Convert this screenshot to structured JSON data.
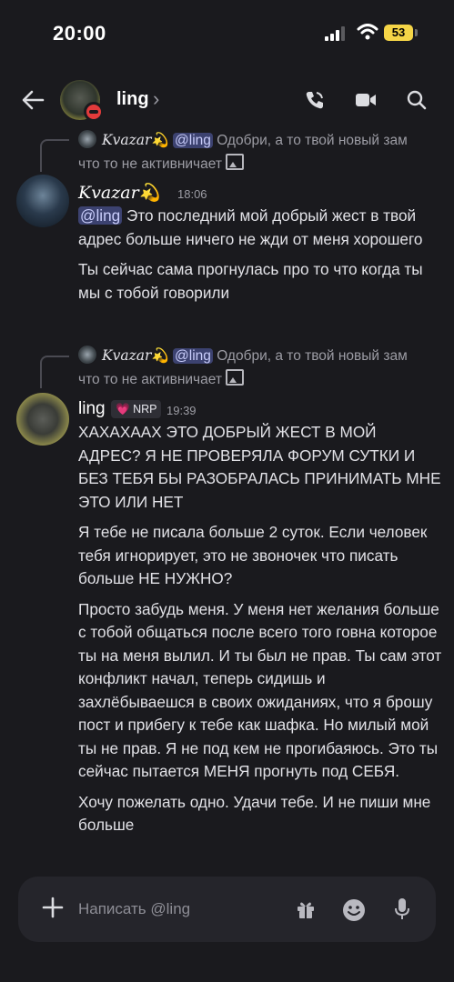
{
  "status_bar": {
    "time": "20:00",
    "battery": "53"
  },
  "header": {
    "title": "ling",
    "chevron": "›"
  },
  "messages": [
    {
      "reply": {
        "author": "𝐾𝑣𝑎𝑧𝑎𝑟💫",
        "mention": "@ling",
        "text_1": " Одобри, а то твой новый зам",
        "text_2": "что то не активничает"
      },
      "author": "𝐾𝑣𝑎𝑧𝑎𝑟💫",
      "time": "18:06",
      "mention": "@ling",
      "paragraphs": [
        " Это последний мой добрый жест в твой адрес больше ничего не жди от меня хорошего",
        "Ты сейчас сама прогнулась про то что когда ты мы с тобой говорили"
      ]
    },
    {
      "reply": {
        "author": "𝐾𝑣𝑎𝑧𝑎𝑟💫",
        "mention": "@ling",
        "text_1": " Одобри, а то твой новый зам",
        "text_2": "что то не активничает"
      },
      "author": "ling",
      "badge": "NRP",
      "time": "19:39",
      "paragraphs": [
        "ХАХАХААХ ЭТО ДОБРЫЙ ЖЕСТ В МОЙ АДРЕС? Я НЕ ПРОВЕРЯЛА ФОРУМ СУТКИ И БЕЗ ТЕБЯ БЫ РАЗОБРАЛАСЬ ПРИНИМАТЬ МНЕ ЭТО ИЛИ НЕТ",
        "Я тебе не писала больше 2 суток. Если человек тебя игнорирует, это не звоночек что писать больше НЕ НУЖНО?",
        "Просто забудь меня. У меня нет желания больше с тобой общаться после всего того говна которое ты на меня вылил. И ты был не прав. Ты сам этот конфликт начал, теперь сидишь и захлёбываешся в своих ожиданиях, что я брошу пост и прибегу к тебе как шафка. Но милый мой ты не прав. Я не под кем не прогибаяюсь. Это ты сейчас пытается МЕНЯ прогнуть под СЕБЯ.",
        "Хочу пожелать одно. Удачи тебе. И не пиши мне больше"
      ]
    }
  ],
  "composer": {
    "placeholder": "Написать @ling"
  },
  "icons": [
    "back-arrow-icon",
    "phone-icon",
    "video-icon",
    "search-icon",
    "plus-icon",
    "gift-icon",
    "emoji-icon",
    "mic-icon",
    "image-icon"
  ]
}
